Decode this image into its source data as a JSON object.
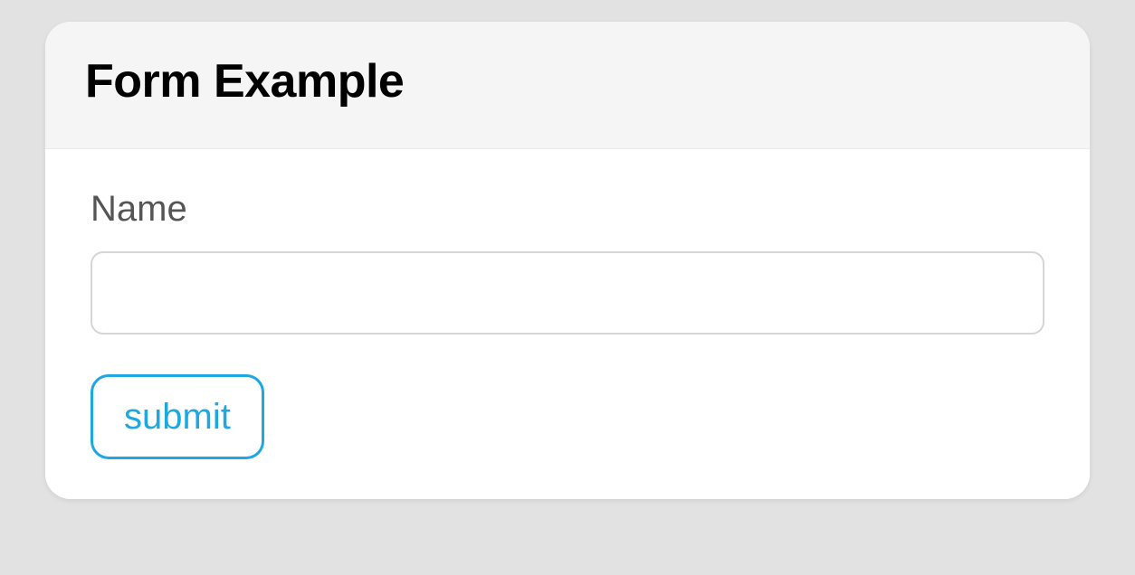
{
  "card": {
    "title": "Form Example"
  },
  "form": {
    "name_label": "Name",
    "name_value": "",
    "submit_label": "submit"
  }
}
